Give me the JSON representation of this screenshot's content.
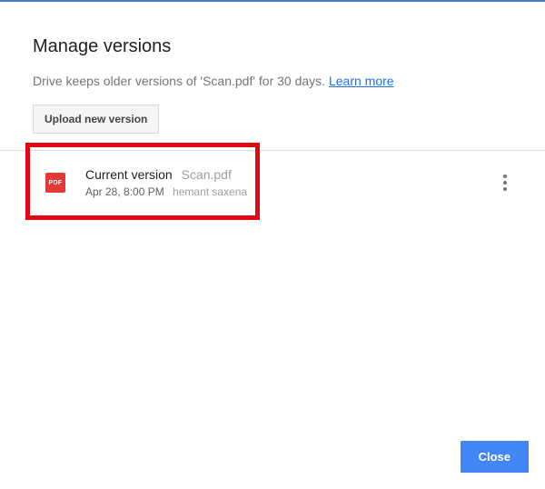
{
  "dialog": {
    "title": "Manage versions",
    "description_prefix": "Drive keeps older versions of '",
    "description_filename": "Scan.pdf",
    "description_suffix": "' for 30 days. ",
    "learn_more": "Learn more",
    "upload_button": "Upload new version",
    "close_button": "Close"
  },
  "versions": [
    {
      "icon_label": "PDF",
      "current_label": "Current version",
      "filename": "Scan.pdf",
      "timestamp": "Apr 28, 8:00 PM",
      "author": "hemant saxena"
    }
  ]
}
